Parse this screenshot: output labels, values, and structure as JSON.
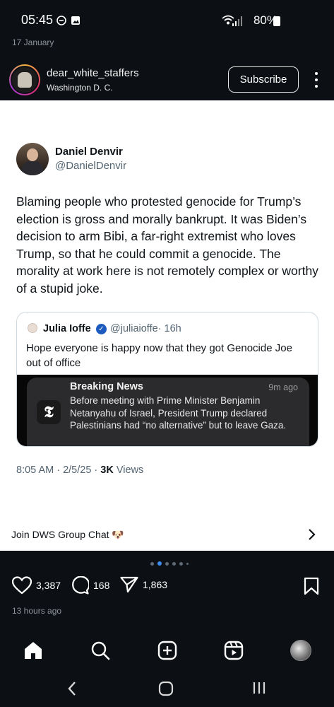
{
  "status_bar": {
    "time": "05:45",
    "battery": "80%"
  },
  "post_date": "17 January",
  "header": {
    "username": "dear_white_staffers",
    "location": "Washington D. C.",
    "subscribe_label": "Subscribe"
  },
  "tweet": {
    "name": "Daniel Denvir",
    "handle": "@DanielDenvir",
    "text": "Blaming people who protested genocide for Trump’s election is gross and morally bankrupt. It was Biden’s decision to arm Bibi, a far-right extremist who loves Trump, so that he could commit a genocide. The morality at work here is not remotely complex or worthy of a stupid joke.",
    "quote": {
      "name": "Julia Ioffe",
      "handle": "@juliaioffe",
      "time": "· 16h",
      "text": "Hope everyone is happy now that they got Genocide Joe out of office",
      "notification": {
        "title": "Breaking News",
        "ago": "9m ago",
        "body": "Before meeting with Prime Minister Benjamin Netanyahu of Israel, President Trump declared Palestinians had “no alternative” but to leave Gaza."
      }
    },
    "timestamp": "8:05 AM · 2/5/25 · ",
    "views_count": "3K",
    "views_label": " Views"
  },
  "group_chat_label": "Join DWS Group Chat 🐶",
  "carousel": {
    "active_index": 1,
    "total": 6
  },
  "actions": {
    "likes": "3,387",
    "comments": "168",
    "shares": "1,863"
  },
  "posted_ago": "13 hours ago",
  "icons": {
    "nav": [
      "home-icon",
      "search-icon",
      "create-icon",
      "reels-icon",
      "profile-avatar"
    ],
    "system": [
      "back-icon",
      "home-circle-icon",
      "recents-icon"
    ]
  }
}
